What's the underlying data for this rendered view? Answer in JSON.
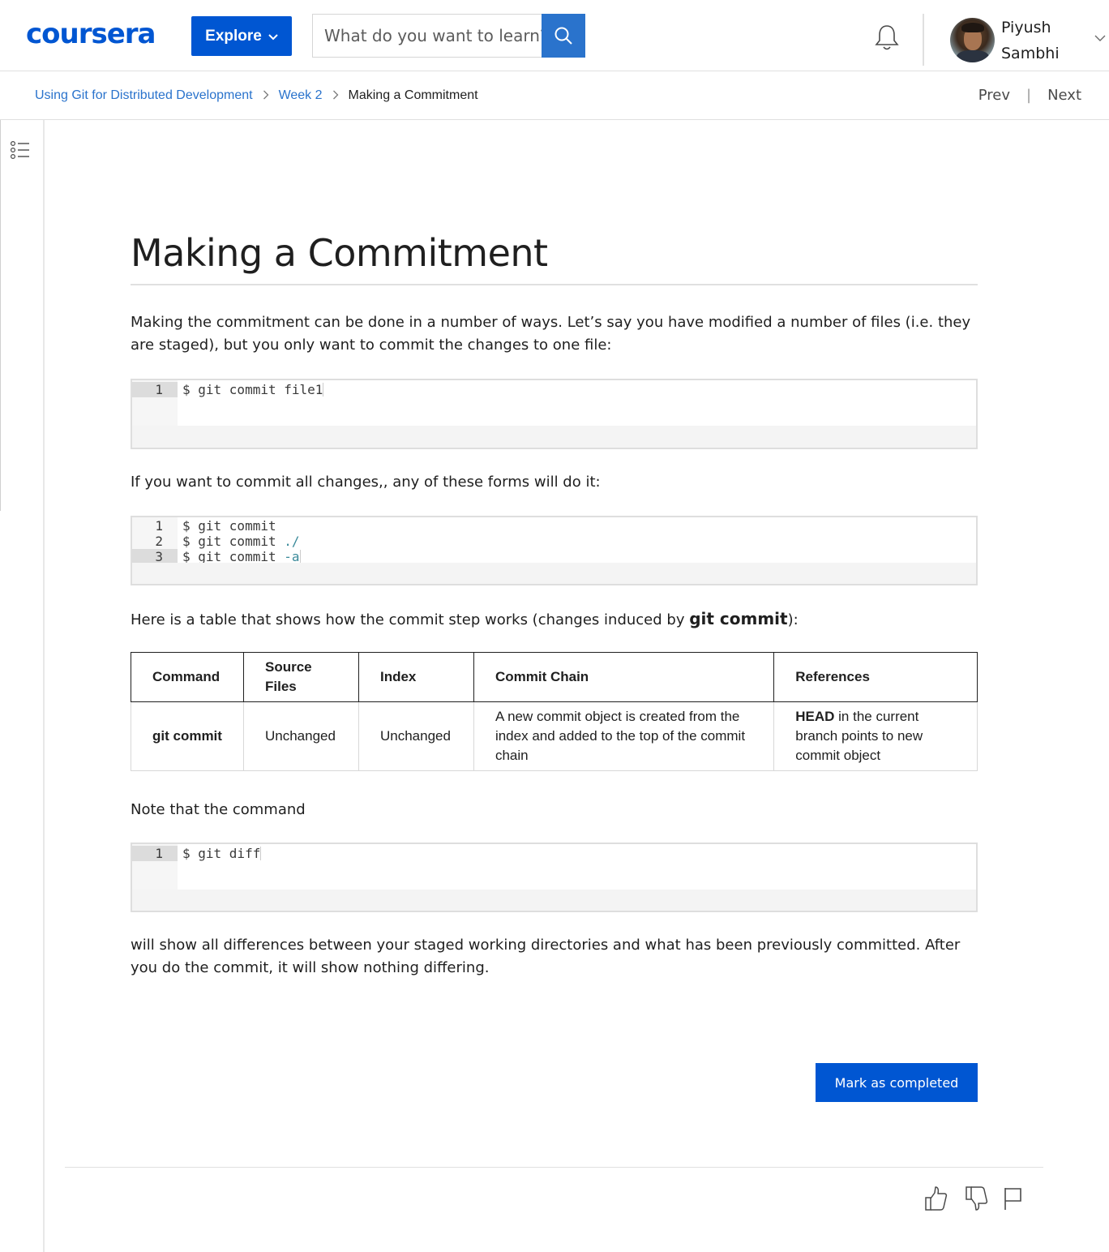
{
  "header": {
    "logo": "coursera",
    "explore_label": "Explore",
    "search_placeholder": "What do you want to learn?",
    "user_first": "Piyush",
    "user_last": "Sambhi"
  },
  "breadcrumb": {
    "course": "Using Git for Distributed Development",
    "week": "Week 2",
    "current": "Making a Commitment",
    "prev": "Prev",
    "separator": "|",
    "next": "Next"
  },
  "article": {
    "title": "Making a Commitment",
    "para1": "Making the commitment can be done in a number of ways. Let’s say you have modified a number of files (i.e. they are staged), but you only want to commit the changes to one file:",
    "code1": [
      {
        "ln": "1",
        "text": "$ git commit file1"
      }
    ],
    "para2": "If you want to commit all changes,, any of these forms will do it:",
    "code2": [
      {
        "ln": "1",
        "text": "$ git commit"
      },
      {
        "ln": "2",
        "text": "$ git commit ",
        "flag": "./"
      },
      {
        "ln": "3",
        "text": "$ git commit ",
        "flag": "-a"
      }
    ],
    "para3_pre": "Here is a table that shows how the commit step works (changes induced by ",
    "para3_bold": "git commit",
    "para3_post": "):",
    "table": {
      "headers": [
        "Command",
        "Source Files",
        "Index",
        "Commit Chain",
        "References"
      ],
      "row": {
        "command": "git commit",
        "source_files": "Unchanged",
        "index": "Unchanged",
        "commit_chain": "A new commit object is created from the index and added to the top of the commit chain",
        "ref_bold": "HEAD",
        "ref_rest": " in the current branch points to new commit object"
      }
    },
    "para4": "Note that the command",
    "code3": [
      {
        "ln": "1",
        "text": "$ git diff"
      }
    ],
    "para5": "will show all differences between your staged working directories and what has been previously committed. After you do the commit, it will show nothing differing."
  },
  "footer": {
    "mark_completed": "Mark as completed"
  },
  "colors": {
    "brand": "#0056d2",
    "link": "#2a73cc"
  },
  "icons": [
    "search-icon",
    "bell-icon",
    "chevron-down-icon",
    "toc-icon",
    "thumbs-up-icon",
    "thumbs-down-icon",
    "flag-icon"
  ]
}
